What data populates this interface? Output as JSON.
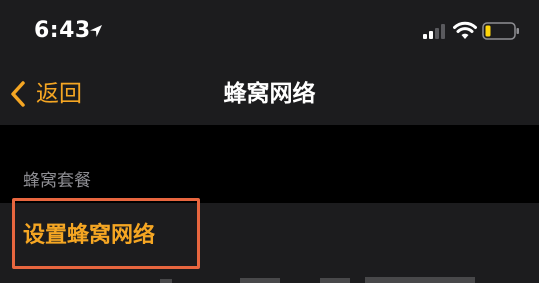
{
  "status_bar": {
    "time": "6:43",
    "location_icon": "location-arrow-icon",
    "signal_icon": "cellular-signal-icon",
    "wifi_icon": "wifi-icon",
    "battery_icon": "battery-low-icon",
    "battery_color": "#ffd60a"
  },
  "nav_bar": {
    "back_label": "返回",
    "title": "蜂窝网络"
  },
  "section": {
    "header": "蜂窝套餐"
  },
  "cell": {
    "label": "设置蜂窝网络"
  },
  "colors": {
    "accent": "#f5a623",
    "highlight_box": "#e8663f",
    "header_bg": "#1c1c1e",
    "background": "#000000",
    "secondary_text": "#8e8e93"
  }
}
